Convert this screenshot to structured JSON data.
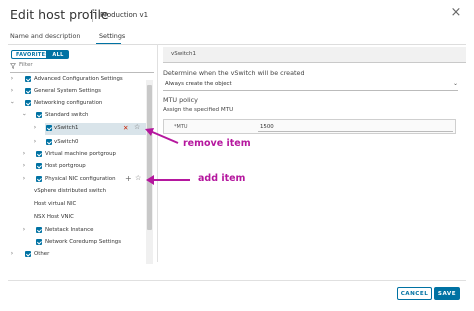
{
  "dialog": {
    "title": "Edit host profile",
    "subtitle": "Production v1",
    "close_glyph": "×"
  },
  "tabs": [
    {
      "label": "Name and description",
      "active": false
    },
    {
      "label": "Settings",
      "active": true
    }
  ],
  "toggle": {
    "favorites": "FAVORITES",
    "all": "ALL",
    "selected": "ALL"
  },
  "filter": {
    "placeholder": "Filter",
    "icon": "filter-icon"
  },
  "tree": [
    {
      "label": "Advanced Configuration Settings",
      "expanded": false,
      "checked": true
    },
    {
      "label": "General System Settings",
      "expanded": false,
      "checked": true
    },
    {
      "label": "Networking configuration",
      "expanded": true,
      "checked": true
    },
    {
      "label": "Standard switch",
      "expanded": true,
      "checked": true
    },
    {
      "label": "vSwitch1",
      "expanded": false,
      "checked": true,
      "selected": true
    },
    {
      "label": "vSwitch0",
      "expanded": false,
      "checked": true
    },
    {
      "label": "Virtual machine portgroup",
      "expanded": false,
      "checked": true
    },
    {
      "label": "Host portgroup",
      "expanded": false,
      "checked": true
    },
    {
      "label": "Physical NIC configuration",
      "expanded": false,
      "checked": true
    },
    {
      "label": "vSphere distributed switch"
    },
    {
      "label": "Host virtual NIC"
    },
    {
      "label": "NSX Host VNIC"
    },
    {
      "label": "Netstack Instance",
      "expanded": false,
      "checked": true
    },
    {
      "label": "Network Coredump Settings",
      "checked": true
    },
    {
      "label": "Other",
      "expanded": false,
      "checked": true
    }
  ],
  "row_actions": {
    "remove_glyph": "✕",
    "star_glyph": "☆",
    "add_glyph": "+"
  },
  "right_panel": {
    "header": "vSwitch1",
    "determine_label": "Determine when the vSwitch will be created",
    "determine_value": "Always create the object",
    "mtu_policy_label": "MTU policy",
    "assign_label": "Assign the specified MTU",
    "mtu_field_label": "*MTU",
    "mtu_value": "1500"
  },
  "footer": {
    "cancel": "CANCEL",
    "save": "SAVE"
  },
  "annotations": {
    "remove": "remove item",
    "add": "add item",
    "color": "#b5179e"
  },
  "colors": {
    "accent": "#0072a3",
    "remove": "#c92100",
    "selected_row": "#d9e4ea"
  }
}
